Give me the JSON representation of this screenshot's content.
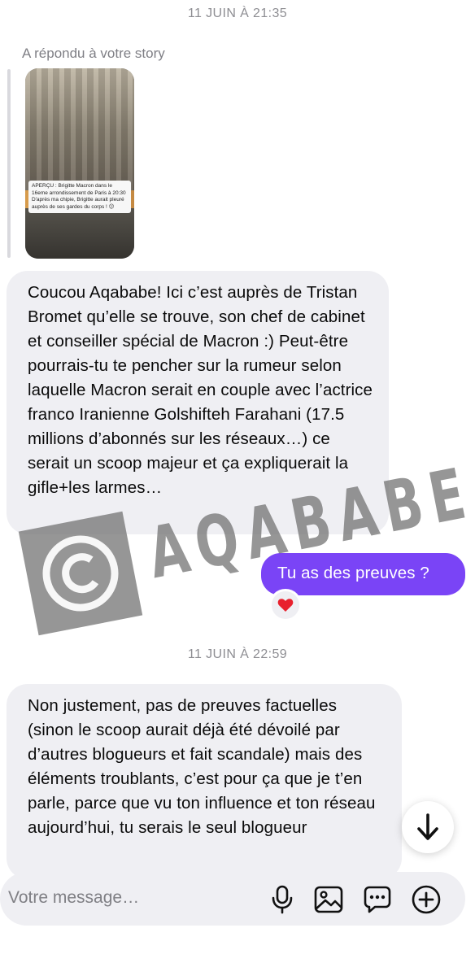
{
  "thread": {
    "timestamp_1": "11 JUIN À 21:35",
    "story_reply_label": "A répondu à votre story",
    "story_caption": "APERÇU : Brigitte Macron dans le 16eme arrondissement de Paris à 20:30 D'après ma chipie, Brigitte aurait pleuré auprès de ses gardes du corps ! 😕",
    "message_1": "Coucou Aqababe! Ici c’est auprès de Tristan Bromet qu’elle se trouve, son chef de cabinet et conseiller spécial de Macron :) Peut-être pourrais-tu te pencher sur la rumeur selon laquelle Macron serait en couple avec l’actrice franco Iranienne Golshifteh Farahani (17.5 millions d’abonnés sur les réseaux…) ce serait un scoop majeur et ça expliquerait la gifle+les larmes…",
    "message_2": "Tu as des preuves ?",
    "reaction_emoji": "❤️",
    "timestamp_2": "11 JUIN À 22:59",
    "message_3": "Non justement, pas de preuves factuelles (sinon le scoop aurait déjà été dévoilé par d’autres blogueurs et fait scandale) mais des éléments troublants, c’est pour ça que je t’en parle, parce que vu ton influence et ton réseau aujourd’hui, tu serais le seul blogueur"
  },
  "watermark": {
    "text": "AQABABE",
    "symbol": "©"
  },
  "composer": {
    "placeholder": "Votre message…"
  },
  "icons": {
    "scroll_down": "arrow-down-icon",
    "mic": "microphone-icon",
    "gallery": "image-icon",
    "sticker": "chat-bubble-icon",
    "plus": "plus-circle-icon"
  },
  "colors": {
    "outgoing_bubble": "#7a44f6",
    "incoming_bubble": "#efeff3",
    "timestamp": "#8e8e93"
  }
}
